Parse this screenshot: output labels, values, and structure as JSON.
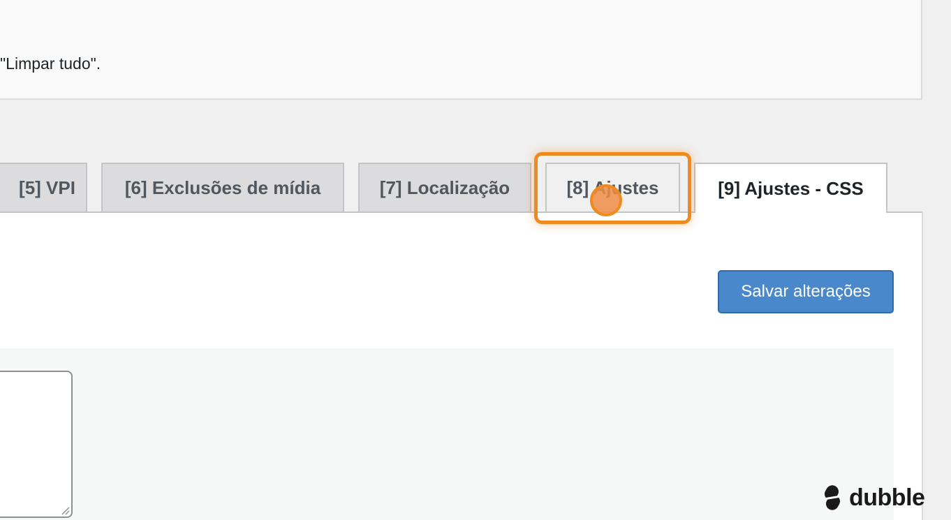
{
  "notice": {
    "text": "\"Limpar tudo\"."
  },
  "tabs": [
    {
      "label": "[5] VPI",
      "active": false
    },
    {
      "label": "[6] Exclusões de mídia",
      "active": false
    },
    {
      "label": "[7] Localização",
      "active": false
    },
    {
      "label": "[8] Ajustes",
      "active": false,
      "highlighted": true
    },
    {
      "label": "[9] Ajustes - CSS",
      "active": true
    }
  ],
  "actions": {
    "save_label": "Salvar alterações"
  },
  "editor": {
    "css_value": ""
  },
  "brand": {
    "name": "dubble"
  },
  "colors": {
    "accent_highlight": "#ef8a1f",
    "primary_button": "#4a88cc"
  }
}
